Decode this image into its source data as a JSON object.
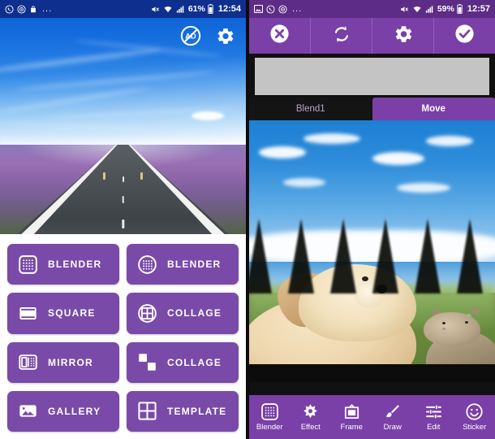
{
  "left_screen": {
    "status_bar": {
      "background_color": "#0e2f8e",
      "left_icons": [
        "whatsapp-icon",
        "camera-icon",
        "bag-icon",
        "more-dots-icon"
      ],
      "dots": "...",
      "right_icons": [
        "mute-icon",
        "wifi-icon",
        "signal-icon",
        "battery-icon"
      ],
      "battery": "61%",
      "time": "12:54"
    },
    "hero": {
      "description": "Road through lavender field under blue sky",
      "no_ads_icon_label": "AD",
      "icons": [
        "no-ads-icon",
        "settings-gear-icon"
      ]
    },
    "buttons": [
      {
        "label": "BLENDER",
        "icon": "blender-grid-square-icon"
      },
      {
        "label": "BLENDER",
        "icon": "blender-grid-circle-icon"
      },
      {
        "label": "SQUARE",
        "icon": "square-frame-icon"
      },
      {
        "label": "COLLAGE",
        "icon": "collage-circle-grid-icon"
      },
      {
        "label": "MIRROR",
        "icon": "mirror-icon"
      },
      {
        "label": "COLLAGE",
        "icon": "collage-checker-icon"
      },
      {
        "label": "GALLERY",
        "icon": "gallery-photo-icon"
      },
      {
        "label": "TEMPLATE",
        "icon": "template-grid-icon"
      }
    ],
    "button_color": "#7a4aa8"
  },
  "right_screen": {
    "status_bar": {
      "background_color": "#5d2c86",
      "left_icons": [
        "image-icon",
        "whatsapp-icon",
        "camera-icon",
        "more-dots-icon"
      ],
      "dots": "...",
      "right_icons": [
        "mute-icon",
        "wifi-icon",
        "signal-icon",
        "battery-icon"
      ],
      "battery": "59%",
      "time": "12:57"
    },
    "toolbar": {
      "background_color": "#7b3fa8",
      "items": [
        {
          "name": "close-button",
          "icon": "close-circle-icon"
        },
        {
          "name": "swap-button",
          "icon": "swap-refresh-icon"
        },
        {
          "name": "settings-button",
          "icon": "settings-gear-icon"
        },
        {
          "name": "confirm-button",
          "icon": "check-circle-icon"
        }
      ]
    },
    "preview_strip": {
      "background_color": "#c4c4c4"
    },
    "tabs": [
      {
        "label": "Blend1",
        "active": false
      },
      {
        "label": "Move",
        "active": true
      }
    ],
    "canvas": {
      "description": "Salt flat landscape blended with puppy and kitten photo, dark triangular spikes overlay"
    },
    "bottom_toolbar": {
      "background_color": "#7b3fa8",
      "items": [
        {
          "label": "Blender",
          "icon": "blender-grid-square-icon"
        },
        {
          "label": "Effect",
          "icon": "effect-flower-icon"
        },
        {
          "label": "Frame",
          "icon": "frame-icon"
        },
        {
          "label": "Draw",
          "icon": "draw-brush-icon"
        },
        {
          "label": "Edit",
          "icon": "edit-sliders-icon"
        },
        {
          "label": "Sticker",
          "icon": "sticker-smiley-icon"
        }
      ]
    }
  }
}
